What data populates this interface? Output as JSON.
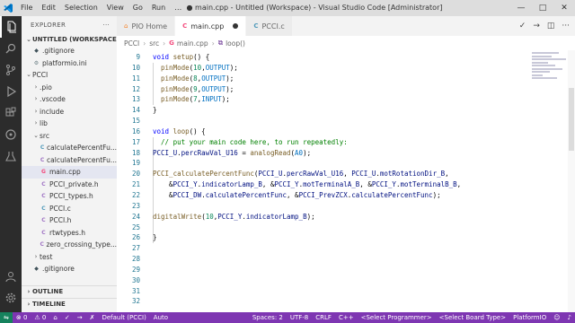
{
  "titlebar": {
    "menu": [
      "File",
      "Edit",
      "Selection",
      "View",
      "Go",
      "Run",
      "…"
    ],
    "title": "● main.cpp - Untitled (Workspace) - Visual Studio Code [Administrator]",
    "minimize": "—",
    "maximize": "□",
    "close": "✕"
  },
  "sidebar": {
    "header": "EXPLORER",
    "header_more": "···",
    "workspace": "UNTITLED (WORKSPACE)",
    "items": [
      {
        "label": ".gitignore",
        "icon": "git"
      },
      {
        "label": "platformio.ini",
        "icon": "ini"
      },
      {
        "label": "PCCI",
        "folder": true
      },
      {
        "label": ".pio",
        "folder": true
      },
      {
        "label": ".vscode",
        "folder": true
      },
      {
        "label": "include",
        "folder": true
      },
      {
        "label": "lib",
        "folder": true
      },
      {
        "label": "src",
        "folder": true
      },
      {
        "label": "calculatePercentFu...",
        "icon": "c"
      },
      {
        "label": "calculatePercentFu...",
        "icon": "c"
      },
      {
        "label": "main.cpp",
        "icon": "cpp"
      },
      {
        "label": "PCCI_private.h",
        "icon": "h"
      },
      {
        "label": "PCCI_types.h",
        "icon": "h"
      },
      {
        "label": "PCCI.c",
        "icon": "c"
      },
      {
        "label": "PCCI.h",
        "icon": "h"
      },
      {
        "label": "rtwtypes.h",
        "icon": "h"
      },
      {
        "label": "zero_crossing_type...",
        "icon": "h"
      },
      {
        "label": "test",
        "folder": true
      },
      {
        "label": ".gitignore",
        "icon": "git"
      }
    ],
    "outline": "OUTLINE",
    "timeline": "TIMELINE"
  },
  "tabs": [
    {
      "label": "PIO Home",
      "icon": "⌂"
    },
    {
      "label": "main.cpp",
      "icon": "C",
      "active": true,
      "dirty": true
    },
    {
      "label": "PCCI.c",
      "icon": "C"
    }
  ],
  "breadcrumbs": [
    "PCCI",
    "src",
    "main.cpp",
    "loop()"
  ],
  "editor": {
    "line_numbers": [
      "9",
      "10",
      "11",
      "12",
      "13",
      "14",
      "15",
      "16",
      "17",
      "18",
      "19",
      "20",
      "21",
      "22",
      "23",
      "24",
      "25",
      "26",
      "27",
      "28",
      "29",
      "30",
      "31",
      "32"
    ]
  },
  "status": {
    "errors": "⊗ 0",
    "warnings": "⚠ 0",
    "home": "⌂",
    "build": "✓",
    "upload": "→",
    "clean": "✗",
    "env": "Default (PCCI)",
    "auto": "Auto",
    "spaces": "Spaces: 2",
    "encoding": "UTF-8",
    "eol": "CRLF",
    "lang": "C++",
    "programmer": "<Select Programmer>",
    "board": "<Select Board Type>",
    "platformio": "PlatformIO",
    "feedback": "☺",
    "bell": "♪"
  },
  "colors": {
    "status_bar": "#7e36b2",
    "activity_bar": "#2c2c2c",
    "keyword": "#0000ff",
    "comment": "#008000"
  }
}
